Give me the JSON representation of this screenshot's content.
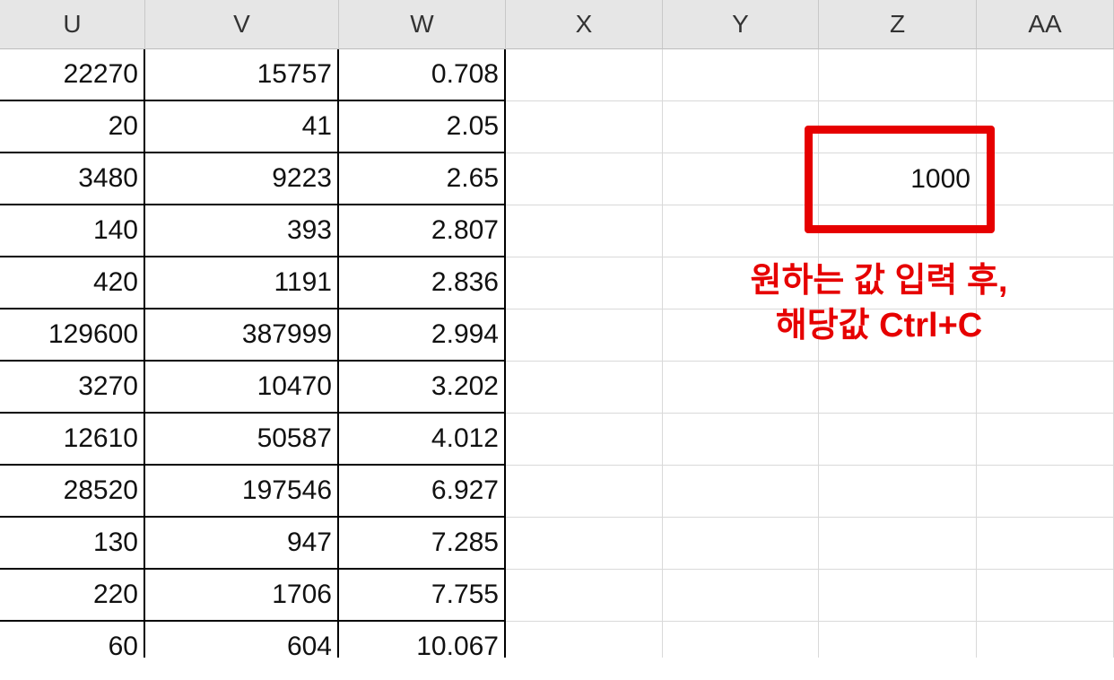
{
  "columns": [
    "U",
    "V",
    "W",
    "X",
    "Y",
    "Z",
    "AA"
  ],
  "rows": [
    [
      "22270",
      "15757",
      "0.708"
    ],
    [
      "20",
      "41",
      "2.05"
    ],
    [
      "3480",
      "9223",
      "2.65"
    ],
    [
      "140",
      "393",
      "2.807"
    ],
    [
      "420",
      "1191",
      "2.836"
    ],
    [
      "129600",
      "387999",
      "2.994"
    ],
    [
      "3270",
      "10470",
      "3.202"
    ],
    [
      "12610",
      "50587",
      "4.012"
    ],
    [
      "28520",
      "197546",
      "6.927"
    ],
    [
      "130",
      "947",
      "7.285"
    ],
    [
      "220",
      "1706",
      "7.755"
    ],
    [
      "60",
      "604",
      "10.067"
    ]
  ],
  "input_cell": {
    "column": "Z",
    "row": 3,
    "value": "1000"
  },
  "annotation": {
    "line1": "원하는 값 입력 후,",
    "line2": "해당값 Ctrl+C",
    "color": "#e60000"
  },
  "colors": {
    "header_bg": "#e6e6e6",
    "gridline": "#d9d9d9",
    "table_border": "#000000",
    "highlight": "#e60000"
  }
}
